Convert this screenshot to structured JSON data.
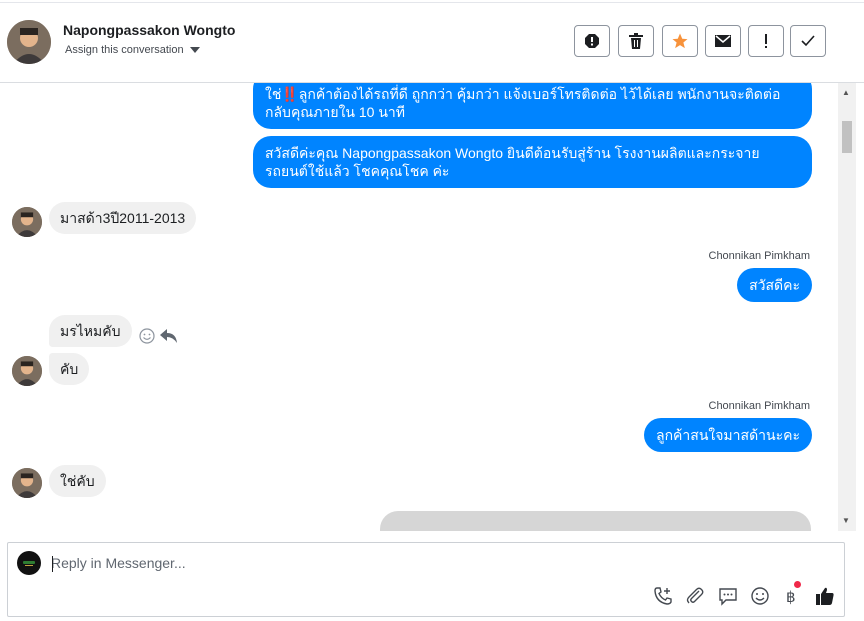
{
  "header": {
    "name": "Napongpassakon Wongto",
    "assign_label": "Assign this conversation",
    "actions": [
      "spam-icon",
      "trash-icon",
      "star-icon",
      "mail-icon",
      "exclamation-icon",
      "check-icon"
    ],
    "star_color": "#f7923b"
  },
  "messages": {
    "out1": "ใช่‼️ลูกค้าต้องได้รถที่ดี ถูกกว่า คุ้มกว่า แจ้งเบอร์โทรติดต่อ ไว้ได้เลย พนักงานจะติดต่อกลับคุณภายใน 10 นาที",
    "out2": "สวัสดีค่ะคุณ Napongpassakon Wongto ยินดีต้อนรับสู่ร้าน โรงงานผลิตและกระจายรถยนต์ใช้แล้ว โชคคุณโชค ค่ะ",
    "in1": "มาสด้า3ปี2011-2013",
    "sender1": "Chonnikan Pimkham",
    "out3": "สวัสดีคะ",
    "in2": "มรไหมคับ",
    "in3": "คับ",
    "sender2": "Chonnikan Pimkham",
    "out4": "ลูกค้าสนใจมาสด้านะคะ",
    "in4": "ใช่คับ"
  },
  "composer": {
    "placeholder": "Reply in Messenger...",
    "icons": [
      "call-add-icon",
      "attachment-icon",
      "saved-reply-icon",
      "emoji-icon",
      "payment-icon",
      "thumbs-up-icon"
    ]
  },
  "colors": {
    "outgoing_bubble": "#0084ff",
    "incoming_bubble": "#f0f0f0",
    "accent": "#1877f2",
    "notification_dot": "#f02849"
  }
}
